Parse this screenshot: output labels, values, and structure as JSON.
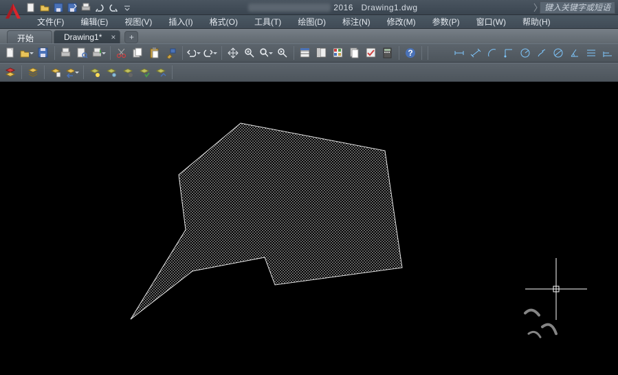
{
  "title": {
    "year": "2016",
    "filename": "Drawing1.dwg"
  },
  "search": {
    "placeholder": "键入关键字或短语"
  },
  "menus": {
    "file": "文件(F)",
    "edit": "编辑(E)",
    "view": "视图(V)",
    "insert": "插入(I)",
    "format": "格式(O)",
    "tools": "工具(T)",
    "draw": "绘图(D)",
    "dim": "标注(N)",
    "modify": "修改(M)",
    "param": "参数(P)",
    "window": "窗口(W)",
    "help": "帮助(H)"
  },
  "tabs": {
    "start": "开始",
    "drawing": "Drawing1*",
    "add": "+"
  },
  "qat": {
    "new": "new",
    "open": "open",
    "save": "save",
    "saveas": "saveas",
    "plot": "plot",
    "undo": "undo",
    "redo": "redo"
  },
  "toolbar_a": [
    "qnew",
    "open",
    "save",
    "print",
    "plot-preview",
    "publish",
    "sep",
    "cut",
    "copy",
    "paste",
    "match",
    "sep",
    "undo",
    "redo",
    "sep",
    "pan",
    "zoom-realtime",
    "zoom-window",
    "zoom-prev",
    "sep",
    "properties",
    "design-center",
    "tool-palettes",
    "sheets",
    "markup",
    "qcalc",
    "sep",
    "help",
    "sep",
    "sep"
  ],
  "toolbar_b": [
    "line",
    "polyline",
    "arc",
    "circle",
    "sep",
    "ellipse",
    "donut",
    "spline",
    "fillet",
    "sep",
    "polygon",
    "cloud"
  ],
  "toolbar_c": [
    "dim-linear",
    "dim-aligned",
    "dim-arc",
    "dim-ord",
    "dim-radius",
    "dim-diam",
    "dim-ang",
    "dim-quick",
    "dim-base",
    "dim-cont"
  ],
  "toolbar_d": [
    "layer",
    "layer-state",
    "layer-prev",
    "sep",
    "iso",
    "freeze",
    "lock",
    "color",
    "apply",
    "sep"
  ],
  "icons": {
    "folder": "📁",
    "disk": "💾",
    "printer": "🖨",
    "scissors": "✂",
    "copy": "⧉",
    "paste": "📋",
    "undo": "↶",
    "redo": "↷",
    "hand": "✋",
    "zoom": "🔍",
    "help": "?"
  }
}
